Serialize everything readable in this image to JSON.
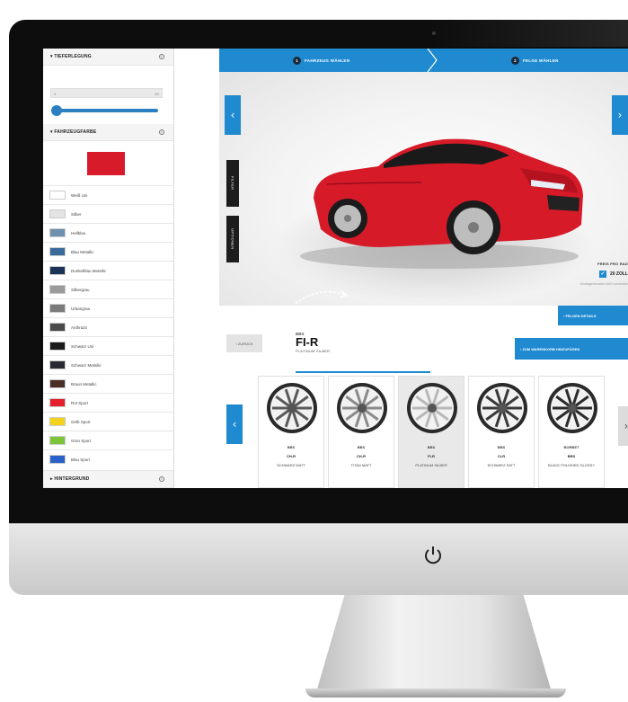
{
  "sidebar": {
    "section_depth": {
      "title": "TIEFERLEGUNG",
      "info": "i",
      "min": "0",
      "max": "60"
    },
    "section_color": {
      "title": "FAHRZEUGFARBE",
      "info": "i",
      "selected_color": "#d81b2b"
    },
    "colors": [
      {
        "label": "Weiß Uni",
        "color": "#ffffff"
      },
      {
        "label": "Silber",
        "color": "#e4e4e4"
      },
      {
        "label": "Hellblau",
        "color": "#6f8fae"
      },
      {
        "label": "Blau Metallic",
        "color": "#3a6a9a"
      },
      {
        "label": "Dunkelblau Metallic",
        "color": "#1b3356"
      },
      {
        "label": "Silbergrau",
        "color": "#9b9b9b"
      },
      {
        "label": "Urbangrau",
        "color": "#7b7b7b"
      },
      {
        "label": "Anthrazit",
        "color": "#4a4a4a"
      },
      {
        "label": "Schwarz Uni",
        "color": "#1a1a1a"
      },
      {
        "label": "Schwarz Metallic",
        "color": "#2a2a32"
      },
      {
        "label": "Braun Metallic",
        "color": "#4a2f24"
      },
      {
        "label": "Rot Sport",
        "color": "#e3202c"
      },
      {
        "label": "Gelb Sport",
        "color": "#f2d21b"
      },
      {
        "label": "Grün Sport",
        "color": "#7cc53a"
      },
      {
        "label": "Blau Sport",
        "color": "#2a62c9"
      }
    ],
    "section_background": {
      "title": "HINTERGRUND",
      "info": "i"
    }
  },
  "steps": [
    {
      "num": "1",
      "label": "FAHRZEUG WÄHLEN"
    },
    {
      "num": "2",
      "label": "FELGE WÄHLEN"
    }
  ],
  "stage": {
    "left_arrow": "‹",
    "right_arrow": "›",
    "tab_filter": "FILTER",
    "tab_options": "OPTIONEN",
    "price_label": "PREIS PRO RAD",
    "size_label": "20 ZOLL",
    "check": "✓",
    "note": "Montagehinweise nicht vorhanden",
    "details_button": "› FELGEN DETAILS"
  },
  "product": {
    "back_button": "‹ ZURÜCK",
    "brand": "BBS",
    "name": "FI-R",
    "finish": "PLATINUM SILBER",
    "cart_button": "› ZUM WARENKORB HINZUFÜGEN"
  },
  "carousel": {
    "left_arrow": "‹",
    "right_arrow": "›",
    "rims": [
      {
        "brand": "BBS",
        "model": "CH-R",
        "finish": "SCHWARZ MATT",
        "color": "#5a5a5a"
      },
      {
        "brand": "BBS",
        "model": "CH-R",
        "finish": "TITAN MATT",
        "color": "#8b8b8b"
      },
      {
        "brand": "BBS",
        "model": "FI-R",
        "finish": "PLATINUM SILBER",
        "color": "#b8b8b8"
      },
      {
        "brand": "BBS",
        "model": "CI-R",
        "finish": "SCHWARZ SATT",
        "color": "#3a3a3a"
      },
      {
        "brand": "BORBET",
        "model": "BRS",
        "finish": "BLACK POLISHED GLOSSY",
        "color": "#2b2b2b"
      }
    ]
  },
  "accent_color": "#1f8ad0"
}
